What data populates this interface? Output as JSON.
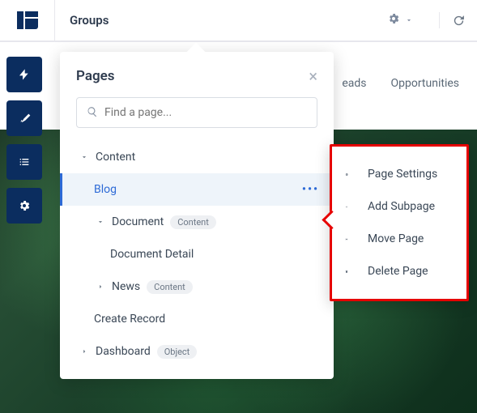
{
  "topbar": {
    "title": "Groups"
  },
  "tabs": {
    "t1": "eads",
    "t2": "Opportunities"
  },
  "panel": {
    "title": "Pages",
    "search_placeholder": "Find a page...",
    "nodes": {
      "content": {
        "label": "Content"
      },
      "blog": {
        "label": "Blog"
      },
      "document": {
        "label": "Document",
        "tag": "Content"
      },
      "docdetail": {
        "label": "Document Detail"
      },
      "news": {
        "label": "News",
        "tag": "Content"
      },
      "create": {
        "label": "Create Record"
      },
      "dashboard": {
        "label": "Dashboard",
        "tag": "Object"
      }
    }
  },
  "ctx": {
    "settings": "Page Settings",
    "add": "Add Subpage",
    "move": "Move Page",
    "delete": "Delete Page"
  }
}
